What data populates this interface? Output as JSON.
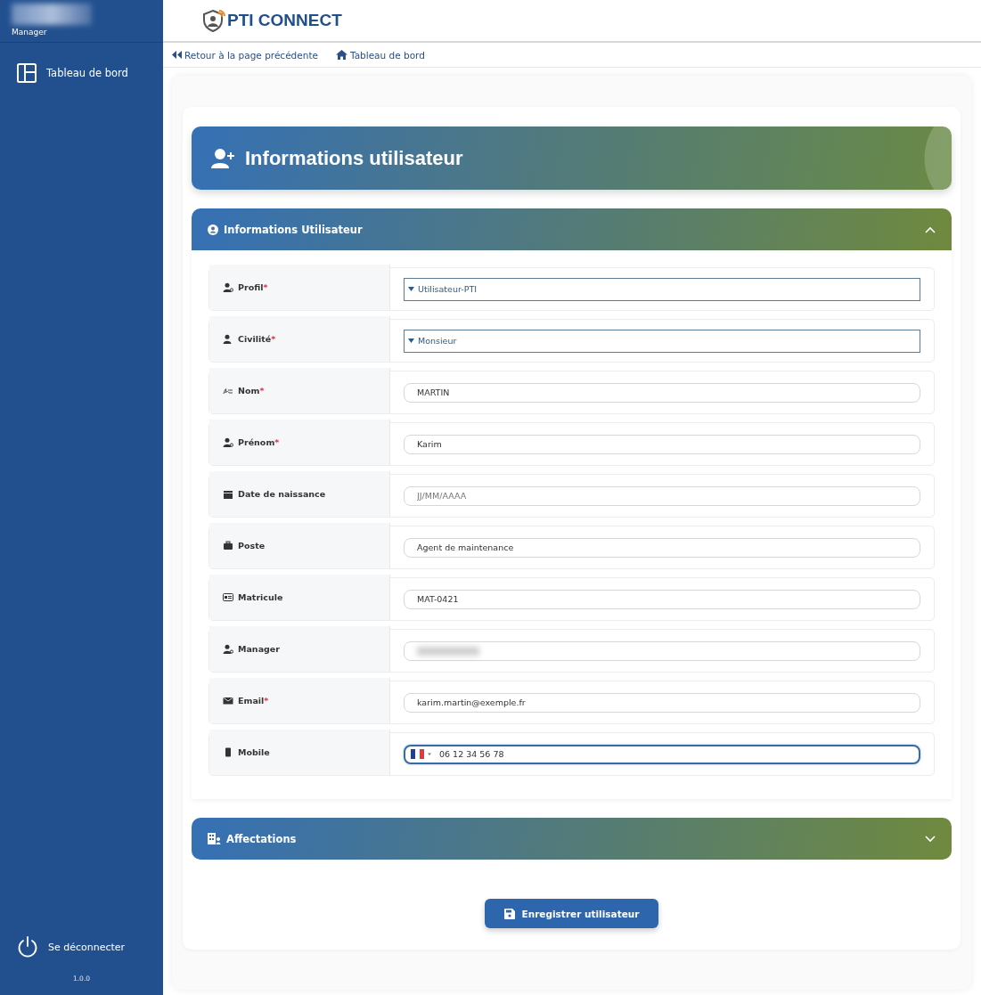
{
  "sidebar": {
    "role": "Manager",
    "items": [
      {
        "label": "Tableau de bord",
        "selected": false
      }
    ],
    "logout": "Se déconnecter",
    "version": "1.0.0"
  },
  "header": {
    "brand": "PTI CONNECT"
  },
  "breadcrumbs": [
    {
      "kind": "back",
      "label": "Retour à la page précédente"
    },
    {
      "kind": "home",
      "label": "Tableau de bord"
    }
  ],
  "page_title": "Informations utilisateur",
  "sections": [
    {
      "title": "Informations Utilisateur",
      "kind": "user",
      "expanded": true,
      "fields": [
        {
          "label": "Profil",
          "required_mark": "*",
          "kind": "select",
          "value": "Utilisateur-PTI",
          "focused": false
        },
        {
          "label": "Civilité",
          "required_mark": "*",
          "kind": "select",
          "value": "Monsieur",
          "focused": false
        },
        {
          "label": "Nom",
          "required_mark": "*",
          "kind": "text",
          "value": "MARTIN",
          "focused": false
        },
        {
          "label": "Prénom",
          "required_mark": "*",
          "kind": "text",
          "value": "Karim",
          "focused": false
        },
        {
          "label": "Date de naissance",
          "kind": "text",
          "placeholder": "JJ/MM/AAAA",
          "focused": false
        },
        {
          "label": "Poste",
          "kind": "text",
          "value": "Agent de maintenance",
          "focused": false
        },
        {
          "label": "Matricule",
          "kind": "text",
          "value": "MAT-0421",
          "focused": false
        },
        {
          "label": "Manager",
          "kind": "redacted",
          "focused": false
        },
        {
          "label": "Email",
          "required_mark": "*",
          "kind": "text",
          "value": "karim.martin@exemple.fr",
          "focused": false
        },
        {
          "label": "Mobile",
          "kind": "phone",
          "value": "06 12 34 56 78",
          "focused": true
        }
      ]
    },
    {
      "title": "Affectations",
      "kind": "building",
      "expanded": false
    }
  ],
  "save_button": "Enregistrer utilisateur"
}
